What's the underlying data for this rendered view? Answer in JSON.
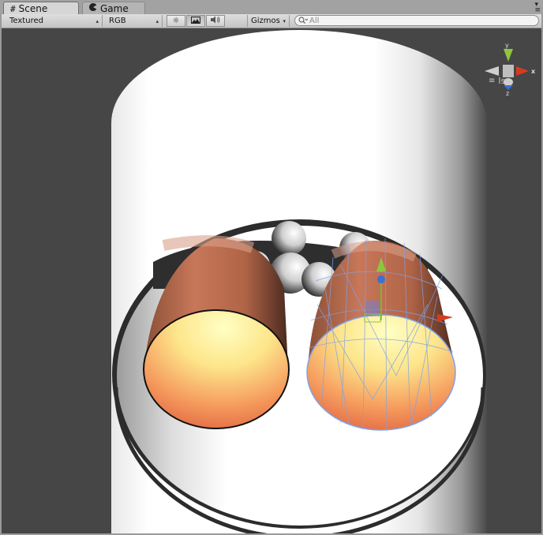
{
  "tabs": [
    {
      "label": "Scene",
      "icon": "grid-icon",
      "active": true
    },
    {
      "label": "Game",
      "icon": "pacman-icon",
      "active": false
    }
  ],
  "toolbar": {
    "draw_mode": "Textured",
    "render_mode": "RGB",
    "gizmos_label": "Gizmos",
    "search_placeholder": "All",
    "buttons": [
      "sun-icon",
      "image-icon",
      "speaker-icon"
    ]
  },
  "scene_gizmo": {
    "axes": [
      "y",
      "x",
      "z"
    ],
    "projection_label": "Iso",
    "colors": {
      "x": "#d63b22",
      "y": "#8ec63f",
      "z": "#3b6fd6"
    }
  },
  "viewport": {
    "background": "#464646"
  }
}
